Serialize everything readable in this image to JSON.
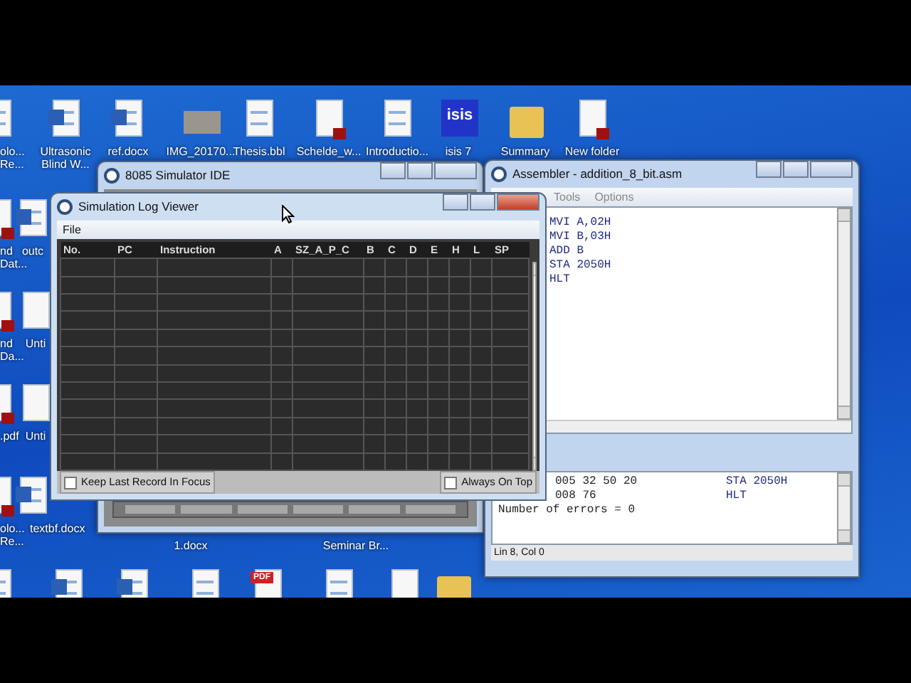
{
  "desktop_icons": [
    {
      "label": "olo...\nRe...",
      "kind": "text"
    },
    {
      "label": "Ultrasonic\nBlind W...",
      "kind": "word"
    },
    {
      "label": "ref.docx",
      "kind": "word"
    },
    {
      "label": "IMG_20170...",
      "kind": "image"
    },
    {
      "label": "Thesis.bbl",
      "kind": "text"
    },
    {
      "label": "Schelde_w...",
      "kind": "pdf"
    },
    {
      "label": "Introductio...",
      "kind": "text"
    },
    {
      "label": "isis 7",
      "kind": "logo",
      "badge": "isis"
    },
    {
      "label": "Summary",
      "kind": "folder"
    },
    {
      "label": "New folder",
      "kind": "pdf"
    },
    {
      "label": "nd\nDat...",
      "kind": "pdf"
    },
    {
      "label": "outc",
      "kind": "word"
    },
    {
      "label": "nd\nDa...",
      "kind": "pdf"
    },
    {
      "label": "Unti",
      "kind": "blank"
    },
    {
      "label": ".pdf",
      "kind": "pdf"
    },
    {
      "label": "Unti",
      "kind": "blank"
    },
    {
      "label": "olo...\nRe...",
      "kind": "pdf"
    },
    {
      "label": "textbf.docx",
      "kind": "word"
    },
    {
      "label": "1.docx",
      "kind": "word"
    },
    {
      "label": "Seminar Br...",
      "kind": "word"
    },
    {
      "kind": "text"
    },
    {
      "kind": "word"
    },
    {
      "kind": "word"
    },
    {
      "kind": "text"
    },
    {
      "kind": "pdf",
      "badge": "PDF"
    },
    {
      "kind": "text"
    },
    {
      "kind": "blank"
    },
    {
      "kind": "folder"
    }
  ],
  "ide_window": {
    "title": "8085 Simulator IDE"
  },
  "log_viewer": {
    "title": "Simulation Log Viewer",
    "menu": [
      "File"
    ],
    "columns": [
      "No.",
      "PC",
      "Instruction",
      "A",
      "SZ_A_P_C",
      "B",
      "C",
      "D",
      "E",
      "H",
      "L",
      "SP"
    ],
    "options": [
      {
        "label": "Keep Last Record In Focus",
        "checked": false
      },
      {
        "label": "Always On Top",
        "checked": false
      }
    ]
  },
  "assembler": {
    "title": "Assembler - addition_8_bit.asm",
    "menu": [
      "Tools",
      "Options"
    ],
    "code_lines": [
      "MVI A,02H",
      "MVI B,03H",
      "ADD B",
      "STA 2050H",
      "HLT"
    ],
    "output_lines": [
      {
        "code": "005 32 50 20",
        "asm": "STA 2050H"
      },
      {
        "code": "008 76",
        "asm": "HLT"
      },
      {
        "code": "Number of errors = 0"
      }
    ],
    "status": "Lin 8, Col 0"
  }
}
